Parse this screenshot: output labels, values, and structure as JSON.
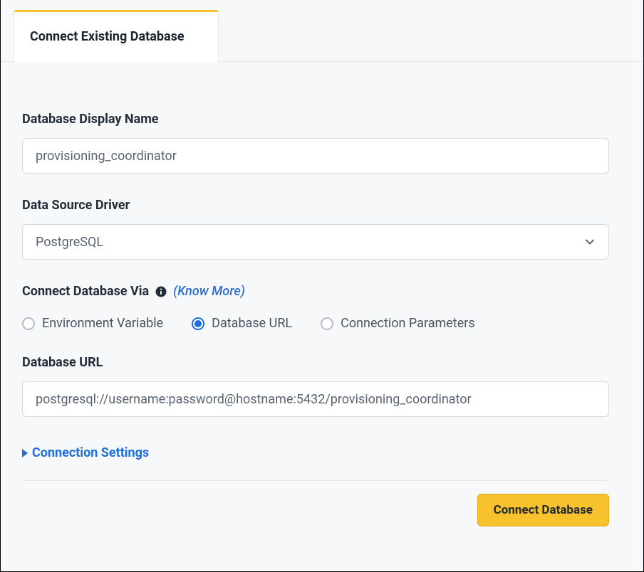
{
  "tab": {
    "label": "Connect Existing Database"
  },
  "fields": {
    "display_name": {
      "label": "Database Display Name",
      "value": "provisioning_coordinator",
      "placeholder": ""
    },
    "driver": {
      "label": "Data Source Driver",
      "value": "PostgreSQL"
    },
    "connect_via": {
      "label": "Connect Database Via",
      "know_more": "(Know More)",
      "options": {
        "env_var": "Environment Variable",
        "db_url": "Database URL",
        "conn_params": "Connection Parameters"
      },
      "selected": "db_url"
    },
    "database_url": {
      "label": "Database URL",
      "value": "postgresql://username:password@hostname:5432/provisioning_coordinator",
      "placeholder": ""
    }
  },
  "collapse": {
    "label": "Connection Settings"
  },
  "actions": {
    "connect": "Connect Database"
  }
}
